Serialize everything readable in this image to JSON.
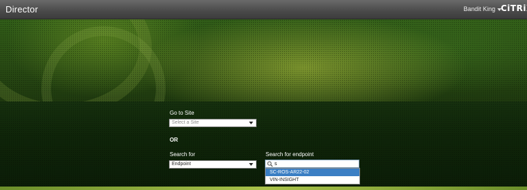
{
  "header": {
    "app_title": "Director",
    "user_name": "Bandit King",
    "logo_text": "CiTRiX"
  },
  "form": {
    "go_to_site_label": "Go to Site",
    "site_placeholder": "Select a Site",
    "or_label": "OR",
    "search_for_label": "Search for",
    "search_for_value": "Endpoint",
    "search_endpoint_label": "Search for endpoint",
    "search_query": "s",
    "results": [
      {
        "label": "SC-ROS-AR22-02",
        "highlighted": true
      },
      {
        "label": "VIN-INSIGHT",
        "highlighted": false
      }
    ]
  },
  "colors": {
    "header_bg": "#4a4a4a",
    "highlight": "#3b7fc4",
    "background_green": "#2a4d14"
  },
  "icons": [
    "chevron-down-icon",
    "search-icon"
  ]
}
